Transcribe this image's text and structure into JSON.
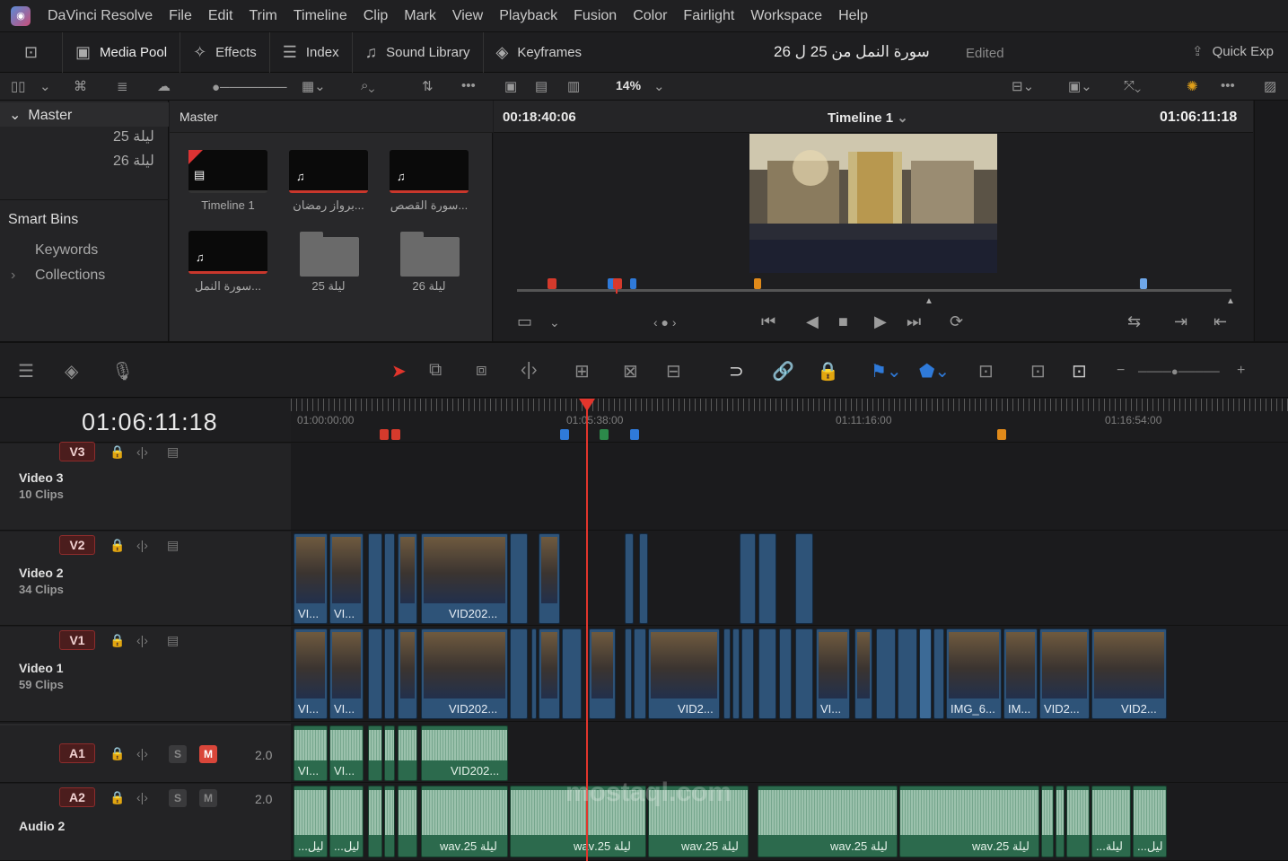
{
  "menubar": {
    "app_name": "DaVinci Resolve",
    "items": [
      "File",
      "Edit",
      "Trim",
      "Timeline",
      "Clip",
      "Mark",
      "View",
      "Playback",
      "Fusion",
      "Color",
      "Fairlight",
      "Workspace",
      "Help"
    ]
  },
  "toolbar": {
    "media_pool": "Media Pool",
    "effects": "Effects",
    "index": "Index",
    "sound_library": "Sound Library",
    "keyframes": "Keyframes",
    "project_title": "سورة النمل من 25 ل 26",
    "status": "Edited",
    "quick_export": "Quick Exp"
  },
  "viewer_bar": {
    "zoom": "14%"
  },
  "bins": {
    "master": "Master",
    "master_items": [
      "ليلة 25",
      "ليلة 26"
    ],
    "smart_bins": "Smart Bins",
    "smart_items": [
      "Keywords",
      "Collections"
    ]
  },
  "media_pool": {
    "header": "Master",
    "clips": [
      {
        "label": "Timeline 1",
        "type": "timeline"
      },
      {
        "label": "...برواز رمضان",
        "type": "audio"
      },
      {
        "label": "...سورة القصص",
        "type": "audio"
      },
      {
        "label": "...سورة النمل",
        "type": "audio"
      },
      {
        "label": "ليلة 25",
        "type": "folder"
      },
      {
        "label": "ليلة 26",
        "type": "folder"
      }
    ]
  },
  "viewer": {
    "source_timecode": "00:18:40:06",
    "timeline_name": "Timeline 1",
    "record_timecode": "01:06:11:18"
  },
  "timeline": {
    "timecode": "01:06:11:18",
    "ruler": [
      "01:00:00:00",
      "01:05:38:00",
      "01:11:16:00",
      "01:16:54:00"
    ],
    "tracks": [
      {
        "id": "V3",
        "name": "Video 3",
        "count": "10 Clips"
      },
      {
        "id": "V2",
        "name": "Video 2",
        "count": "34 Clips"
      },
      {
        "id": "V1",
        "name": "Video 1",
        "count": "59 Clips"
      },
      {
        "id": "A1",
        "name": "",
        "level": "2.0"
      },
      {
        "id": "A2",
        "name": "Audio 2",
        "level": "2.0"
      }
    ],
    "solo_label": "S",
    "mute_label": "M",
    "v2_labels": [
      "VI...",
      "VI...",
      "VID202..."
    ],
    "v1_labels": [
      "VI...",
      "VI...",
      "VID202...",
      "VID2...",
      "VI...",
      "IMG_6...",
      "IM...",
      "VID2...",
      "VID2..."
    ],
    "a1_labels": [
      "VI...",
      "VI...",
      "VID202..."
    ],
    "a2_labels": [
      "ليل...",
      "ليل...",
      "ليلة 25.wav",
      "ليلة 25.wav",
      "ليلة 25.wav",
      "ليلة 25.wav",
      "ليلة 25.wav",
      "ليلة...",
      "ليل..."
    ]
  },
  "colors": {
    "accent_red": "#e2352c",
    "video_clip": "#2e5378",
    "audio_clip": "#2c6a4d",
    "marker_blue": "#2f7ad9",
    "marker_orange": "#e08a1a"
  },
  "watermark": "mostaql.com"
}
